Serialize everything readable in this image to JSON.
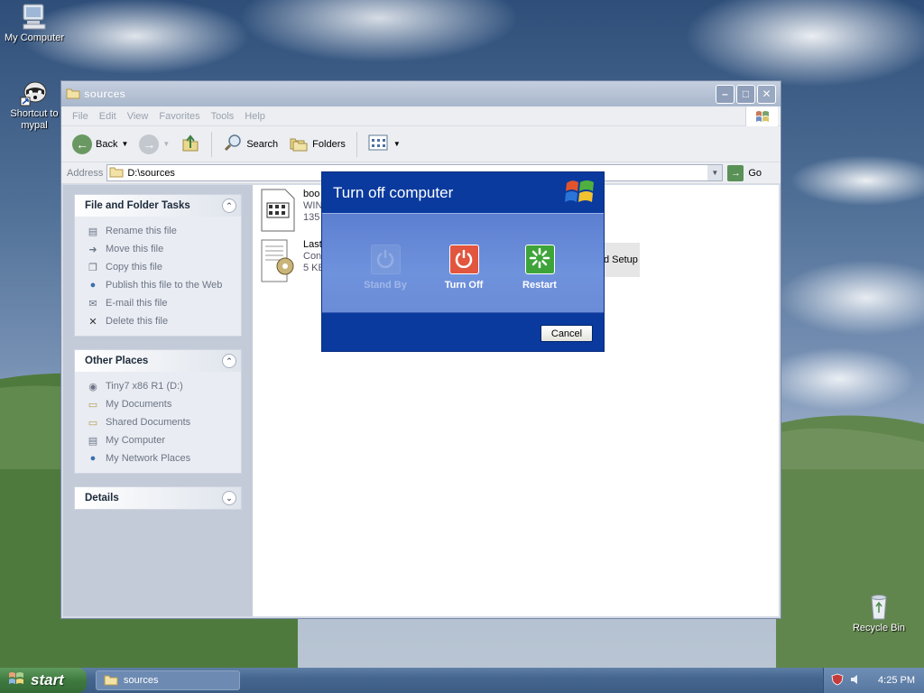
{
  "desktop": {
    "icons": [
      {
        "label": "My Computer"
      },
      {
        "label": "Shortcut to mypal"
      },
      {
        "label": "Recycle Bin"
      }
    ]
  },
  "explorer": {
    "title": "sources",
    "menu": [
      "File",
      "Edit",
      "View",
      "Favorites",
      "Tools",
      "Help"
    ],
    "toolbar": {
      "back": "Back",
      "search": "Search",
      "folders": "Folders"
    },
    "address": {
      "label": "Address",
      "value": "D:\\sources",
      "go": "Go"
    },
    "tasks": {
      "file_folder": {
        "title": "File and Folder Tasks",
        "items": [
          {
            "label": "Rename this file",
            "icon": "rename-icon"
          },
          {
            "label": "Move this file",
            "icon": "move-icon"
          },
          {
            "label": "Copy this file",
            "icon": "copy-icon"
          },
          {
            "label": "Publish this file to the Web",
            "icon": "globe-icon"
          },
          {
            "label": "E-mail this file",
            "icon": "email-icon"
          },
          {
            "label": "Delete this file",
            "icon": "delete-icon"
          }
        ]
      },
      "other_places": {
        "title": "Other Places",
        "items": [
          {
            "label": "Tiny7 x86 R1 (D:)",
            "icon": "cd-drive-icon"
          },
          {
            "label": "My Documents",
            "icon": "folder-icon"
          },
          {
            "label": "Shared Documents",
            "icon": "folder-icon"
          },
          {
            "label": "My Computer",
            "icon": "computer-icon"
          },
          {
            "label": "My Network Places",
            "icon": "network-icon"
          }
        ]
      },
      "details": {
        "title": "Details"
      }
    },
    "files": [
      {
        "name": "boo",
        "line2": "WIN",
        "line3": "135"
      },
      {
        "name": "Last",
        "line2": "Con",
        "line3": "5 KE"
      },
      {
        "partial_label": "d Setup"
      }
    ]
  },
  "dialog": {
    "title": "Turn off computer",
    "options": {
      "stand_by": "Stand By",
      "turn_off": "Turn Off",
      "restart": "Restart"
    },
    "cancel": "Cancel"
  },
  "taskbar": {
    "start": "start",
    "task_label": "sources",
    "clock": "4:25 PM"
  },
  "colors": {
    "dialog_blue": "#0a3a9e",
    "turn_off_red": "#e2553e",
    "restart_green": "#3ea43a"
  }
}
